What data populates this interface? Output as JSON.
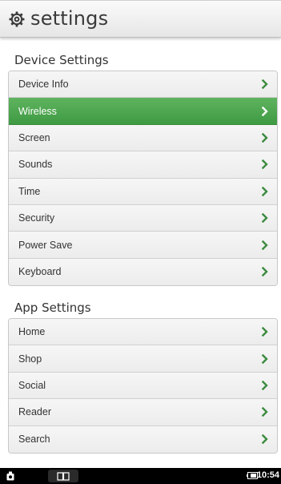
{
  "header": {
    "title": "settings",
    "icon": "gear-icon"
  },
  "device_settings": {
    "heading": "Device Settings",
    "items": [
      {
        "label": "Device Info",
        "selected": false
      },
      {
        "label": "Wireless",
        "selected": true
      },
      {
        "label": "Screen",
        "selected": false
      },
      {
        "label": "Sounds",
        "selected": false
      },
      {
        "label": "Time",
        "selected": false
      },
      {
        "label": "Security",
        "selected": false
      },
      {
        "label": "Power Save",
        "selected": false
      },
      {
        "label": "Keyboard",
        "selected": false
      }
    ]
  },
  "app_settings": {
    "heading": "App Settings",
    "items": [
      {
        "label": "Home",
        "selected": false
      },
      {
        "label": "Shop",
        "selected": false
      },
      {
        "label": "Social",
        "selected": false
      },
      {
        "label": "Reader",
        "selected": false
      },
      {
        "label": "Search",
        "selected": false
      }
    ]
  },
  "status_bar": {
    "time": "10:54",
    "left_icon": "notification-icon",
    "center_icon": "book-icon",
    "battery_icon": "battery-icon"
  },
  "colors": {
    "accent": "#48a04b",
    "chevron": "#3d8b40",
    "chevron_selected": "#ffffff"
  }
}
